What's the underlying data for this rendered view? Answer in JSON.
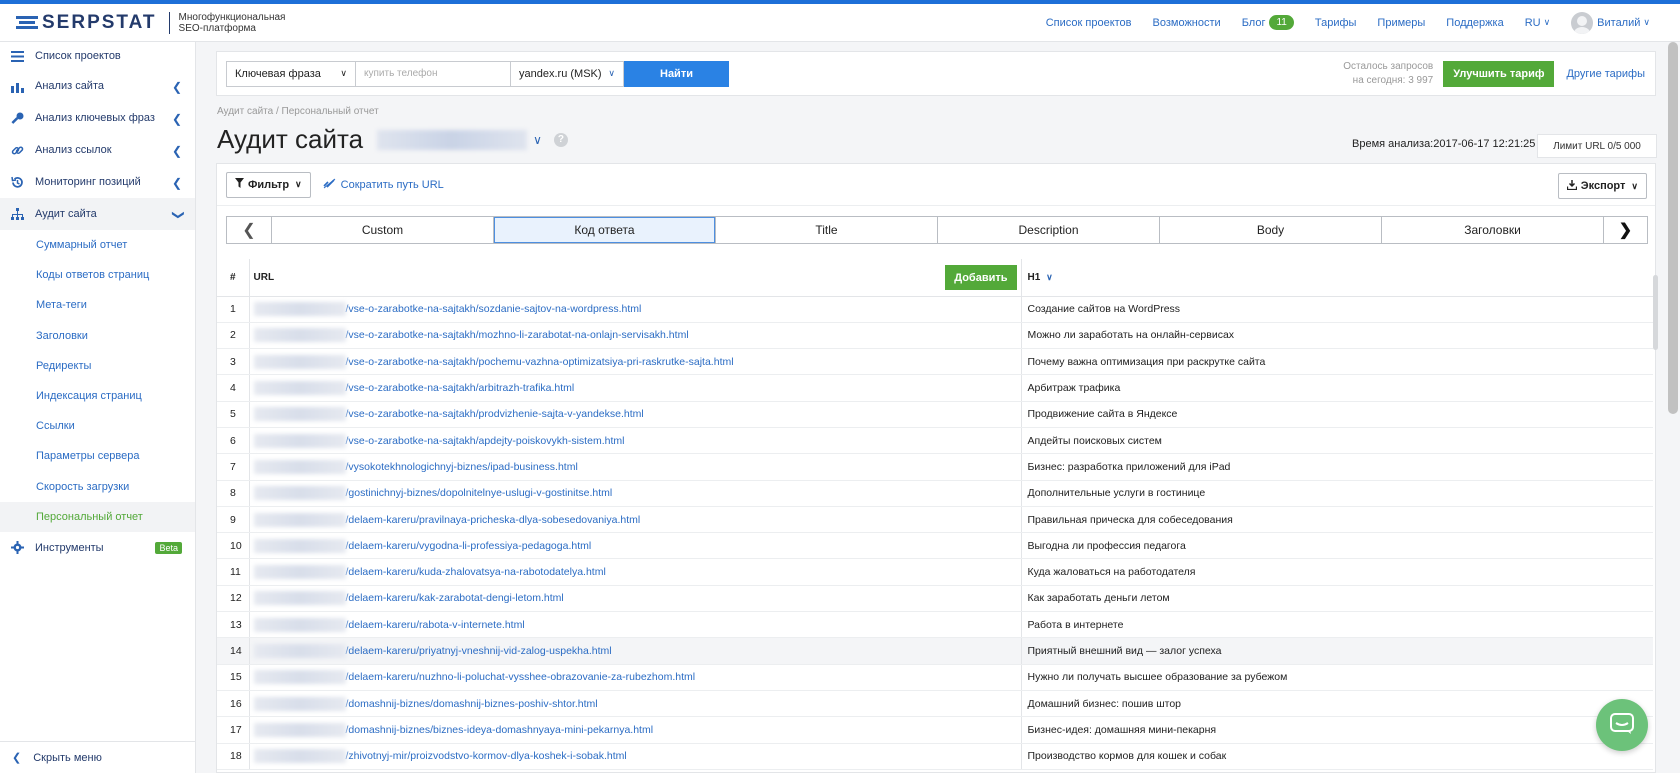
{
  "header": {
    "logo_text": "SERPSTAT",
    "logo_sub_1": "Многофункциональная",
    "logo_sub_2": "SEO-платформа",
    "nav": [
      "Список проектов",
      "Возможности",
      "Блог",
      "Тарифы",
      "Примеры",
      "Поддержка"
    ],
    "blog_badge": "11",
    "lang": "RU",
    "user": "Виталий"
  },
  "sidebar": {
    "projects": "Список проектов",
    "items": [
      "Анализ сайта",
      "Анализ ключевых фраз",
      "Анализ ссылок",
      "Мониторинг позиций",
      "Аудит сайта"
    ],
    "sub": [
      "Суммарный отчет",
      "Коды ответов страниц",
      "Мета-теги",
      "Заголовки",
      "Редиректы",
      "Индексация страниц",
      "Ссылки",
      "Параметры сервера",
      "Скорость загрузки",
      "Персональный отчет"
    ],
    "tools": "Инструменты",
    "beta": "Beta",
    "hide": "Скрыть меню"
  },
  "search": {
    "type": "Ключевая фраза",
    "placeholder": "купить телефон",
    "region": "yandex.ru (MSK)",
    "find": "Найти",
    "quota_1": "Осталось запросов",
    "quota_2": "на сегодня: 3 997",
    "upgrade": "Улучшить тариф",
    "other": "Другие тарифы"
  },
  "breadcrumb": "Аудит сайта / Персональный отчет",
  "page_title": "Аудит сайта",
  "analysis_time": "Время анализа:2017-06-17 12:21:25",
  "limit": "Лимит URL 0/5 000",
  "toolbar": {
    "filter": "Фильтр",
    "shorten": "Сократить путь URL",
    "export": "Экспорт"
  },
  "tabs": [
    "Custom",
    "Код ответа",
    "Title",
    "Description",
    "Body",
    "Заголовки"
  ],
  "table": {
    "headers": {
      "num": "#",
      "url": "URL",
      "add": "Добавить",
      "h1": "H1"
    },
    "rows": [
      {
        "n": "1",
        "url": "/vse-o-zarabotke-na-sajtakh/sozdanie-sajtov-na-wordpress.html",
        "h1": "Создание сайтов на WordPress"
      },
      {
        "n": "2",
        "url": "/vse-o-zarabotke-na-sajtakh/mozhno-li-zarabotat-na-onlajn-servisakh.html",
        "h1": "Можно ли заработать на онлайн-сервисах"
      },
      {
        "n": "3",
        "url": "/vse-o-zarabotke-na-sajtakh/pochemu-vazhna-optimizatsiya-pri-raskrutke-sajta.html",
        "h1": "Почему важна оптимизация при раскрутке сайта"
      },
      {
        "n": "4",
        "url": "/vse-o-zarabotke-na-sajtakh/arbitrazh-trafika.html",
        "h1": "Арбитраж трафика"
      },
      {
        "n": "5",
        "url": "/vse-o-zarabotke-na-sajtakh/prodvizhenie-sajta-v-yandekse.html",
        "h1": "Продвижение сайта в Яндексе"
      },
      {
        "n": "6",
        "url": "/vse-o-zarabotke-na-sajtakh/apdejty-poiskovykh-sistem.html",
        "h1": "Апдейты поисковых систем"
      },
      {
        "n": "7",
        "url": "/vysokotekhnologichnyj-biznes/ipad-business.html",
        "h1": "Бизнес: разработка приложений для iPad"
      },
      {
        "n": "8",
        "url": "/gostinichnyj-biznes/dopolnitelnye-uslugi-v-gostinitse.html",
        "h1": "Дополнительные услуги в гостинице"
      },
      {
        "n": "9",
        "url": "/delaem-kareru/pravilnaya-pricheska-dlya-sobesedovaniya.html",
        "h1": "Правильная прическа для собеседования"
      },
      {
        "n": "10",
        "url": "/delaem-kareru/vygodna-li-professiya-pedagoga.html",
        "h1": "Выгодна ли профессия педагога"
      },
      {
        "n": "11",
        "url": "/delaem-kareru/kuda-zhalovatsya-na-rabotodatelya.html",
        "h1": "Куда жаловаться на работодателя"
      },
      {
        "n": "12",
        "url": "/delaem-kareru/kak-zarabotat-dengi-letom.html",
        "h1": "Как заработать деньги летом"
      },
      {
        "n": "13",
        "url": "/delaem-kareru/rabota-v-internete.html",
        "h1": "Работа в интернете"
      },
      {
        "n": "14",
        "url": "/delaem-kareru/priyatnyj-vneshnij-vid-zalog-uspekha.html",
        "h1": "Приятный внешний вид — залог успеха"
      },
      {
        "n": "15",
        "url": "/delaem-kareru/nuzhno-li-poluchat-vysshee-obrazovanie-za-rubezhom.html",
        "h1": "Нужно ли получать высшее образование за рубежом"
      },
      {
        "n": "16",
        "url": "/domashnij-biznes/domashnij-biznes-poshiv-shtor.html",
        "h1": "Домашний бизнес: пошив штор"
      },
      {
        "n": "17",
        "url": "/domashnij-biznes/biznes-ideya-domashnyaya-mini-pekarnya.html",
        "h1": "Бизнес-идея: домашняя мини-пекарня"
      },
      {
        "n": "18",
        "url": "/zhivotnyj-mir/proizvodstvo-kormov-dlya-koshek-i-sobak.html",
        "h1": "Производство кормов для кошек и собак"
      }
    ]
  },
  "colors": {
    "accent": "#2a82e4",
    "green": "#53a939",
    "link": "#2b6cc4"
  }
}
